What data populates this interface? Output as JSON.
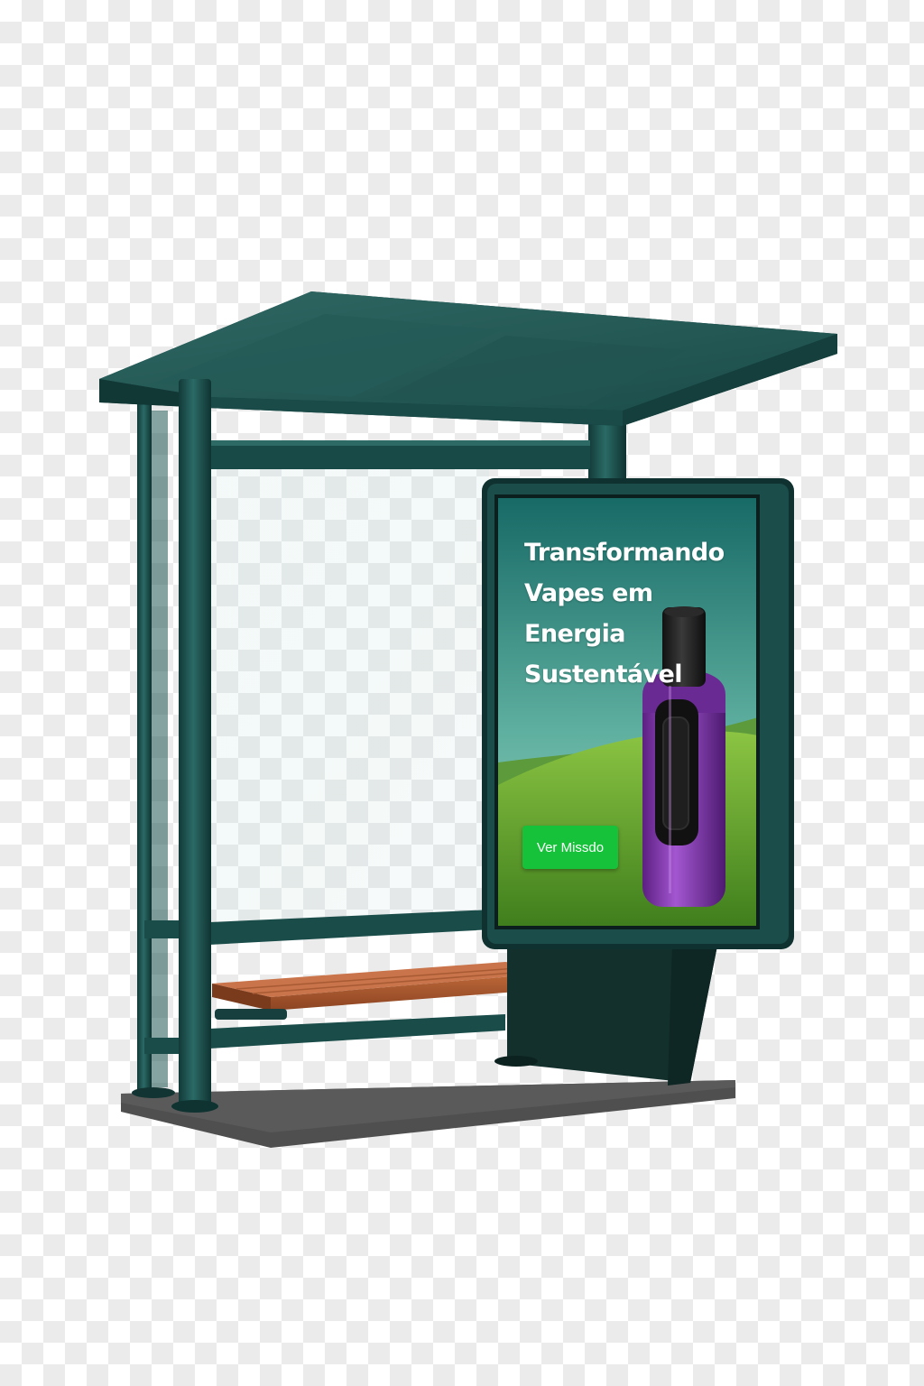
{
  "ad": {
    "headline_lines": [
      "Transformando",
      "Vapes em",
      "Energia",
      "Sustentável"
    ],
    "cta_label": "Ver Missdo"
  },
  "colors": {
    "frame": "#1b4d4a",
    "panel": "#13302d",
    "bench": "#a4552c",
    "cta": "#16c23a",
    "device": "#8b3cb2"
  },
  "icons": [
    "purple-vape-device-icon"
  ]
}
